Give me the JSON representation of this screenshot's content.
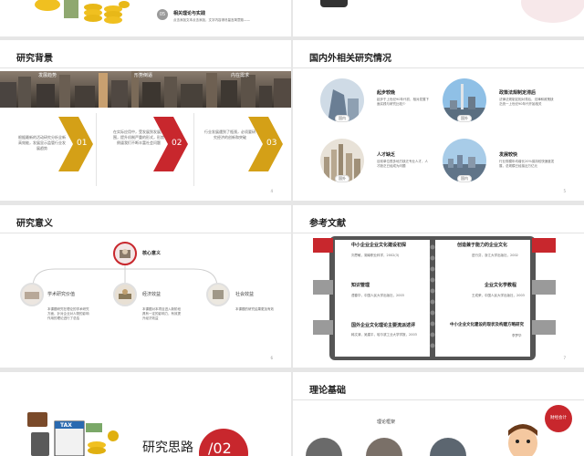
{
  "slides": {
    "s1": {
      "circle_no": "05",
      "heading": "相关理论与实践",
      "desc": "点击添加文本点击添加，文字内容请尽量言简意赅——"
    },
    "s3": {
      "title": "研究背景",
      "tabs": [
        "发展趋势",
        "形势倒逼",
        "内在需求"
      ],
      "cards": [
        {
          "text": "根据最新的活动研究分析全新高效能，发展显示监管行业发展趋势",
          "num": "01"
        },
        {
          "text": "在实际应用中，受发展到发展范围，提升机制严重的形式，形势倒逼我们不断丰富社会问题",
          "num": "02"
        },
        {
          "text": "行业发展遇到了瓶颈，必须要研究经济的创新和突破",
          "num": "03"
        }
      ],
      "page": "4"
    },
    "s4": {
      "title": "国内外相关研究情况",
      "items": [
        {
          "tag": "国内",
          "heading": "起步较晚",
          "text": "起步于上世纪90年代初，相对发展下面实践与研究比较少"
        },
        {
          "tag": "国外",
          "heading": "政策法规制定滞后",
          "text": "法律法规制定相对滞后，法律和政策缺乏统一上世纪90年代开始相关"
        },
        {
          "tag": "国外",
          "heading": "人才缺乏",
          "text": "目前单位很多地方缺乏专业人才，人才缺乏已经成为问题"
        },
        {
          "tag": "国内",
          "heading": "发展较快",
          "text": "行业规模年均增长20%保持较快速度发展，总规模已经接近万亿元"
        }
      ],
      "page": "5"
    },
    "s5": {
      "title": "研究意义",
      "core": "核心意义",
      "nodes": [
        {
          "label": "学术研究价值",
          "text": "本课题研究在理论的学术研究方面，针对企业对人物的影响作用的理论进行了总结"
        },
        {
          "label": "经济效益",
          "text": "本课题对本项目进入新阶段具有一定的影响力，有效提升经济效益"
        },
        {
          "label": "社会效益",
          "text": "本课题的研究结果更加有效"
        }
      ],
      "page": "6"
    },
    "s6": {
      "title": "参考文献",
      "refs": [
        {
          "title": "中小企业企业文化建设初探",
          "author": "刘思敏，湖南职业科学，2002(3)"
        },
        {
          "title": "创造兼于能力的企业文化",
          "author": "进行芬，浙江大学出版社，2002"
        },
        {
          "title": "知识管理",
          "author": "谭春华，中国人民大学出版社，2003"
        },
        {
          "title": "企业文化学教程",
          "author": "王成荣，中国人民大学出版社，2003"
        },
        {
          "title": "国外企业文化理论主要流派述评",
          "author": "韩文清，吴建平，哈尔滨工业大学学报，2003"
        },
        {
          "title": "中小企业文化建设的现状及构建方略研究",
          "author": "李梦华"
        }
      ],
      "page": "7"
    },
    "s7": {
      "title": "研究思路",
      "number": "/02",
      "tax": "TAX"
    },
    "s8": {
      "title": "理论基础",
      "subtitle": "理论框架",
      "bubble": "财经会计"
    }
  },
  "colors": {
    "red": "#c8272d",
    "gold": "#d4a017",
    "gray": "#9a9a9a"
  }
}
